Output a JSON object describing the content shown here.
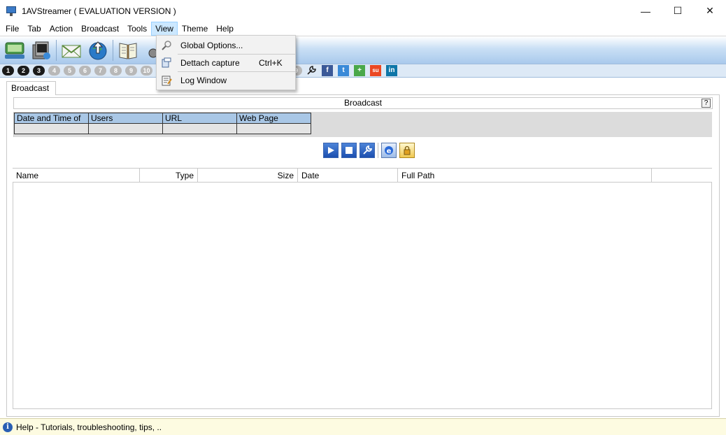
{
  "window": {
    "title": "1AVStreamer ( EVALUATION VERSION )",
    "minimize": "—",
    "maximize": "☐",
    "close": "✕"
  },
  "menubar": {
    "items": [
      "File",
      "Tab",
      "Action",
      "Broadcast",
      "Tools",
      "View",
      "Theme",
      "Help"
    ],
    "active": "View"
  },
  "view_menu": {
    "items": [
      {
        "label": "Global Options...",
        "shortcut": "",
        "icon": "wrench-search-icon"
      },
      {
        "label": "Dettach capture",
        "shortcut": "Ctrl+K",
        "icon": "detach-icon"
      },
      {
        "label": "Log Window",
        "shortcut": "",
        "icon": "log-icon"
      }
    ]
  },
  "numbar": {
    "numbers": [
      "1",
      "2",
      "3",
      "4",
      "5",
      "6",
      "7",
      "8",
      "9",
      "10"
    ],
    "active_count": 3,
    "partial_number": "9",
    "social": [
      "f",
      "t",
      "+",
      "su",
      "in"
    ]
  },
  "tab": {
    "label": "Broadcast"
  },
  "broadcast": {
    "header": "Broadcast",
    "help": "?",
    "columns": [
      "Date and Time of",
      "Users",
      "URL",
      "Web Page"
    ]
  },
  "file_grid": {
    "columns": [
      "Name",
      "Type",
      "Size",
      "Date",
      "Full Path"
    ]
  },
  "status": {
    "text": "Help - Tutorials, troubleshooting, tips, .."
  },
  "colors": {
    "menu_highlight": "#cce8ff",
    "toolbar_gradient_end": "#a9c9ec",
    "table_header": "#a9c7e6",
    "status_bg": "#fdfbe1"
  }
}
